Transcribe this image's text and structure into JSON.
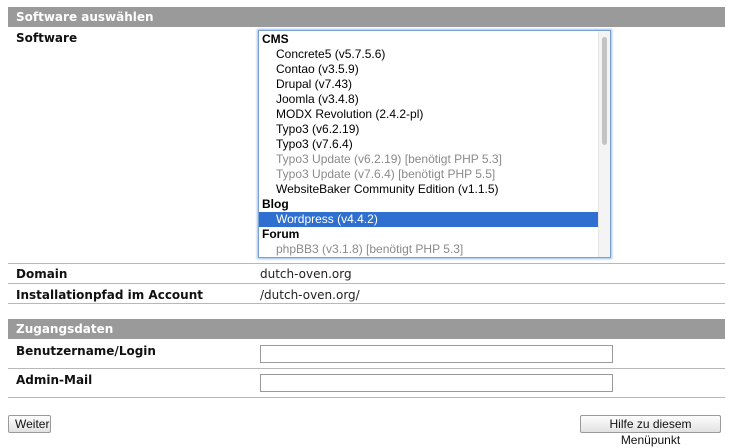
{
  "software_section": {
    "header": "Software auswählen",
    "software_label": "Software",
    "listbox": {
      "items": [
        {
          "type": "group",
          "label": "CMS"
        },
        {
          "type": "option",
          "label": "Concrete5 (v5.7.5.6)",
          "state": "enabled"
        },
        {
          "type": "option",
          "label": "Contao (v3.5.9)",
          "state": "enabled"
        },
        {
          "type": "option",
          "label": "Drupal (v7.43)",
          "state": "enabled"
        },
        {
          "type": "option",
          "label": "Joomla (v3.4.8)",
          "state": "enabled"
        },
        {
          "type": "option",
          "label": "MODX Revolution (2.4.2-pl)",
          "state": "enabled"
        },
        {
          "type": "option",
          "label": "Typo3 (v6.2.19)",
          "state": "enabled"
        },
        {
          "type": "option",
          "label": "Typo3 (v7.6.4)",
          "state": "enabled"
        },
        {
          "type": "option",
          "label": "Typo3 Update (v6.2.19) [benötigt PHP 5.3]",
          "state": "disabled"
        },
        {
          "type": "option",
          "label": "Typo3 Update (v7.6.4) [benötigt PHP 5.5]",
          "state": "disabled"
        },
        {
          "type": "option",
          "label": "WebsiteBaker Community Edition (v1.1.5)",
          "state": "enabled"
        },
        {
          "type": "group",
          "label": "Blog"
        },
        {
          "type": "option",
          "label": "Wordpress (v4.4.2)",
          "state": "selected"
        },
        {
          "type": "group",
          "label": "Forum"
        },
        {
          "type": "option",
          "label": "phpBB3 (v3.1.8) [benötigt PHP 5.3]",
          "state": "disabled"
        }
      ]
    },
    "domain_label": "Domain",
    "domain_value": "dutch-oven.org",
    "path_label": "Installationpfad im Account",
    "path_value": "/dutch-oven.org/"
  },
  "access_section": {
    "header": "Zugangsdaten",
    "username_label": "Benutzername/Login",
    "username_value": "",
    "adminmail_label": "Admin-Mail",
    "adminmail_value": ""
  },
  "buttons": {
    "next": "Weiter",
    "help": "Hilfe zu diesem Menüpunkt"
  },
  "colors": {
    "header_bg": "#9a9a9a",
    "selection_bg": "#2f6fd0",
    "disabled_text": "#8a8a8a",
    "focus_ring": "#7aa0d0"
  }
}
